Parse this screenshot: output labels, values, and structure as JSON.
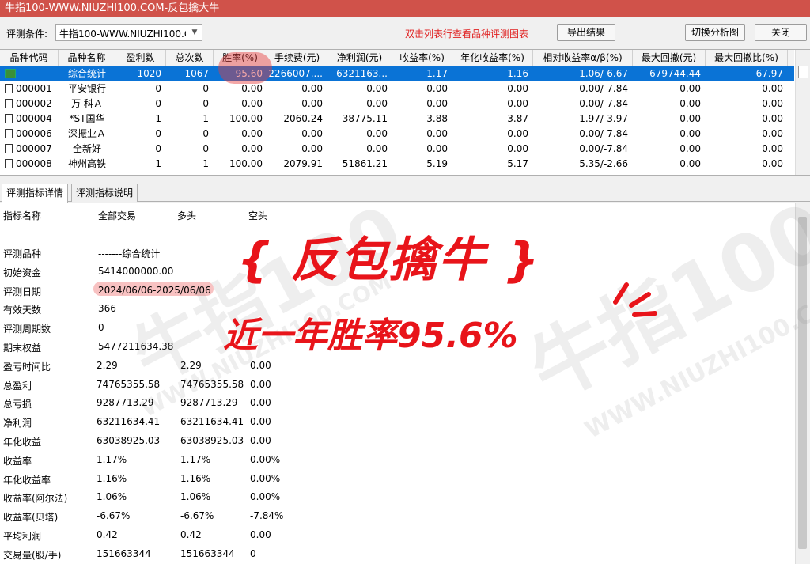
{
  "window": {
    "title": "牛指100-WWW.NIUZHI100.COM-反包擒大牛"
  },
  "toolbar": {
    "condition_label": "评测条件:",
    "condition_value": "牛指100-WWW.NIUZHI100.COM",
    "hint": "双击列表行查看品种评测图表",
    "export_label": "导出结果",
    "switch_label": "切换分析图",
    "close_label": "关闭"
  },
  "grid": {
    "columns": [
      "品种代码",
      "品种名称",
      "盈利数",
      "总次数",
      "胜率(%)",
      "手续费(元)",
      "净利润(元)",
      "收益率(%)",
      "年化收益率(%)",
      "相对收益率α/β(%)",
      "最大回撤(元)",
      "最大回撤比(%)"
    ],
    "rows": [
      [
        "------",
        "综合统计",
        "1020",
        "1067",
        "95.60",
        "2266007....",
        "6321163...",
        "1.17",
        "1.16",
        "1.06/-6.67",
        "679744.44",
        "67.97"
      ],
      [
        "000001",
        "平安银行",
        "0",
        "0",
        "0.00",
        "0.00",
        "0.00",
        "0.00",
        "0.00",
        "0.00/-7.84",
        "0.00",
        "0.00"
      ],
      [
        "000002",
        "万 科Ａ",
        "0",
        "0",
        "0.00",
        "0.00",
        "0.00",
        "0.00",
        "0.00",
        "0.00/-7.84",
        "0.00",
        "0.00"
      ],
      [
        "000004",
        "*ST国华",
        "1",
        "1",
        "100.00",
        "2060.24",
        "38775.11",
        "3.88",
        "3.87",
        "1.97/-3.97",
        "0.00",
        "0.00"
      ],
      [
        "000006",
        "深振业Ａ",
        "0",
        "0",
        "0.00",
        "0.00",
        "0.00",
        "0.00",
        "0.00",
        "0.00/-7.84",
        "0.00",
        "0.00"
      ],
      [
        "000007",
        "全新好",
        "0",
        "0",
        "0.00",
        "0.00",
        "0.00",
        "0.00",
        "0.00",
        "0.00/-7.84",
        "0.00",
        "0.00"
      ],
      [
        "000008",
        "神州高铁",
        "1",
        "1",
        "100.00",
        "2079.91",
        "51861.21",
        "5.19",
        "5.17",
        "5.35/-2.66",
        "0.00",
        "0.00"
      ]
    ]
  },
  "tabs": [
    "评测指标详情",
    "评测指标说明"
  ],
  "detail": {
    "headers": [
      "指标名称",
      "全部交易",
      "多头",
      "空头"
    ],
    "items": [
      {
        "name": "评测品种",
        "all": "-------综合统计",
        "long": "",
        "short": ""
      },
      {
        "name": "初始资金",
        "all": "5414000000.00",
        "long": "",
        "short": ""
      },
      {
        "name": "评测日期",
        "all": "2024/06/06-2025/06/06",
        "long": "",
        "short": ""
      },
      {
        "name": "有效天数",
        "all": "366",
        "long": "",
        "short": ""
      },
      {
        "name": "评测周期数",
        "all": "0",
        "long": "",
        "short": ""
      },
      {
        "name": "期末权益",
        "all": "5477211634.38",
        "long": "",
        "short": ""
      },
      {
        "name": "盈亏时间比",
        "all": "2.29",
        "long": "2.29",
        "short": "0.00"
      },
      {
        "name": "总盈利",
        "all": "74765355.58",
        "long": "74765355.58",
        "short": "0.00"
      },
      {
        "name": "总亏损",
        "all": "9287713.29",
        "long": "9287713.29",
        "short": "0.00"
      },
      {
        "name": "净利润",
        "all": "63211634.41",
        "long": "63211634.41",
        "short": "0.00"
      },
      {
        "name": "年化收益",
        "all": "63038925.03",
        "long": "63038925.03",
        "short": "0.00"
      },
      {
        "name": "收益率",
        "all": "1.17%",
        "long": "1.17%",
        "short": "0.00%"
      },
      {
        "name": "年化收益率",
        "all": "1.16%",
        "long": "1.16%",
        "short": "0.00%"
      },
      {
        "name": "收益率(阿尔法)",
        "all": "1.06%",
        "long": "1.06%",
        "short": "0.00%"
      },
      {
        "name": "收益率(贝塔)",
        "all": "-6.67%",
        "long": "-6.67%",
        "short": "-7.84%"
      },
      {
        "name": "平均利润",
        "all": "0.42",
        "long": "0.42",
        "short": "0.00"
      },
      {
        "name": "交易量(股/手)",
        "all": "151663344",
        "long": "151663344",
        "short": "0"
      }
    ]
  },
  "overlay": {
    "title": "{ 反包擒牛 }",
    "subtitle": "近一年胜率95.6%"
  },
  "watermark": {
    "brand": "牛指100",
    "url": "WWW.NIUZHI100.COM"
  },
  "colors": {
    "accent_red": "#e8141a",
    "selection_blue": "#0a73d6",
    "titlebar": "#d0524a"
  }
}
